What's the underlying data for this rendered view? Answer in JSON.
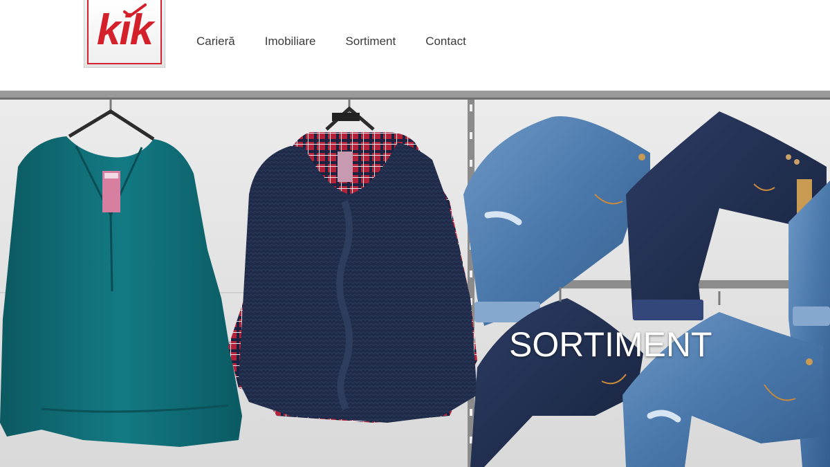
{
  "brand": {
    "logo_text": "kik",
    "color": "#d4202a"
  },
  "nav": {
    "items": [
      {
        "label": "Carieră"
      },
      {
        "label": "Imobiliare"
      },
      {
        "label": "Sortiment"
      },
      {
        "label": "Contact"
      }
    ]
  },
  "hero": {
    "title": "SORTIMENT",
    "colors": {
      "teal_blouse": "#0f6a72",
      "navy_sweater": "#1d2a47",
      "plaid_red": "#b3243a",
      "denim_light": "#4f7fb2",
      "denim_dark": "#1f2d4f"
    }
  }
}
